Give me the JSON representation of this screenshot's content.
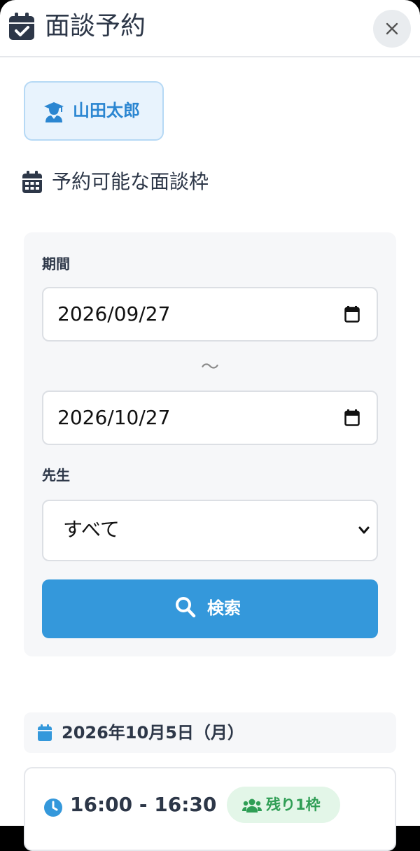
{
  "header": {
    "title": "面談予約",
    "icon": "calendar-check-icon",
    "close_icon": "close-icon"
  },
  "student": {
    "name": "山田太郎",
    "icon": "user-graduate-icon"
  },
  "available": {
    "label": "予約可能な面談枠",
    "icon": "calendar-icon"
  },
  "filter": {
    "period_label": "期間",
    "start_date": "2026/09/27",
    "separator": "～",
    "end_date": "2026/10/27",
    "teacher_label": "先生",
    "teacher_selected": "すべて",
    "search_label": "検索"
  },
  "schedule": {
    "date": "2026年10月5日（月）",
    "slots": [
      {
        "time": "16:00 - 16:30",
        "remaining": "残り1枠"
      }
    ]
  },
  "colors": {
    "accent": "#3498db",
    "student_text": "#2b86d1",
    "badge_green": "#2f9e55"
  }
}
